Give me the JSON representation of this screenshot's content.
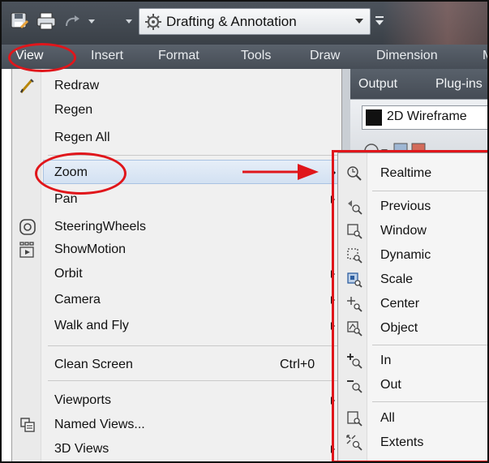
{
  "toolbar": {
    "workspace": "Drafting & Annotation",
    "icons": [
      "save-as-icon",
      "print-icon",
      "redo-icon",
      "customize-dropdown-icon"
    ]
  },
  "menubar": {
    "items": [
      "View",
      "Insert",
      "Format",
      "Tools",
      "Draw",
      "Dimension",
      "M"
    ],
    "active": "View"
  },
  "ribbon": {
    "tabs": [
      "Output",
      "Plug-ins"
    ],
    "visual_style": "2D Wireframe"
  },
  "view_menu": {
    "items": [
      {
        "label": "Redraw",
        "icon": "redraw-pencil-icon"
      },
      {
        "label": "Regen"
      },
      {
        "label": "Regen All"
      },
      {
        "label": "Zoom",
        "submenu": true,
        "highlighted": true
      },
      {
        "label": "Pan",
        "submenu": true
      },
      {
        "label": "SteeringWheels",
        "icon": "steeringwheels-icon"
      },
      {
        "label": "ShowMotion",
        "icon": "showmotion-icon"
      },
      {
        "label": "Orbit",
        "submenu": true
      },
      {
        "label": "Camera",
        "submenu": true
      },
      {
        "label": "Walk and Fly",
        "submenu": true
      },
      {
        "label": "Clean Screen",
        "shortcut": "Ctrl+0"
      },
      {
        "label": "Viewports",
        "submenu": true
      },
      {
        "label": "Named Views...",
        "icon": "named-views-icon"
      },
      {
        "label": "3D Views",
        "submenu": true
      }
    ]
  },
  "zoom_menu": {
    "items": [
      {
        "label": "Realtime",
        "icon": "zoom-realtime-icon"
      },
      {
        "label": "Previous",
        "icon": "zoom-previous-icon"
      },
      {
        "label": "Window",
        "icon": "zoom-window-icon"
      },
      {
        "label": "Dynamic",
        "icon": "zoom-dynamic-icon"
      },
      {
        "label": "Scale",
        "icon": "zoom-scale-icon"
      },
      {
        "label": "Center",
        "icon": "zoom-center-icon"
      },
      {
        "label": "Object",
        "icon": "zoom-object-icon"
      },
      {
        "label": "In",
        "icon": "zoom-in-icon"
      },
      {
        "label": "Out",
        "icon": "zoom-out-icon"
      },
      {
        "label": "All",
        "icon": "zoom-all-icon"
      },
      {
        "label": "Extents",
        "icon": "zoom-extents-icon"
      }
    ]
  },
  "annotation_color": "#e0161b"
}
